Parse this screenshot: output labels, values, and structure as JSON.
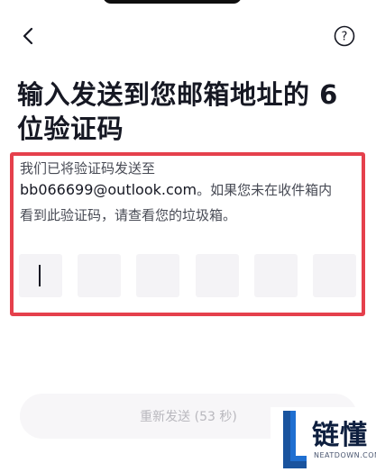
{
  "header": {
    "back_icon": "chevron-left-icon",
    "help_icon": "question-circle-icon",
    "help_symbol": "?"
  },
  "title": {
    "line1": "输入发送到您邮箱地址的 6",
    "line2": "位验证码"
  },
  "description": {
    "line1": "我们已将验证码发送至",
    "email": "bb066699@outlook.com",
    "line2_suffix": "。如果您未在收件箱内",
    "line3": "看到此验证码，请查看您的垃圾箱。"
  },
  "code_input": {
    "length": 6,
    "values": [
      "",
      "",
      "",
      "",
      "",
      ""
    ],
    "active_index": 0
  },
  "resend_button": {
    "label": "重新发送 (53 秒)"
  },
  "watermark": {
    "brand": "链懂",
    "domain": "NEATDOWN.COM"
  },
  "colors": {
    "highlight_border": "#e5404c",
    "code_box_bg": "#f4f3f6",
    "resend_bg": "#f7f6f8",
    "resend_text": "#b9b8be",
    "watermark_blue": "#1f6fd1"
  }
}
